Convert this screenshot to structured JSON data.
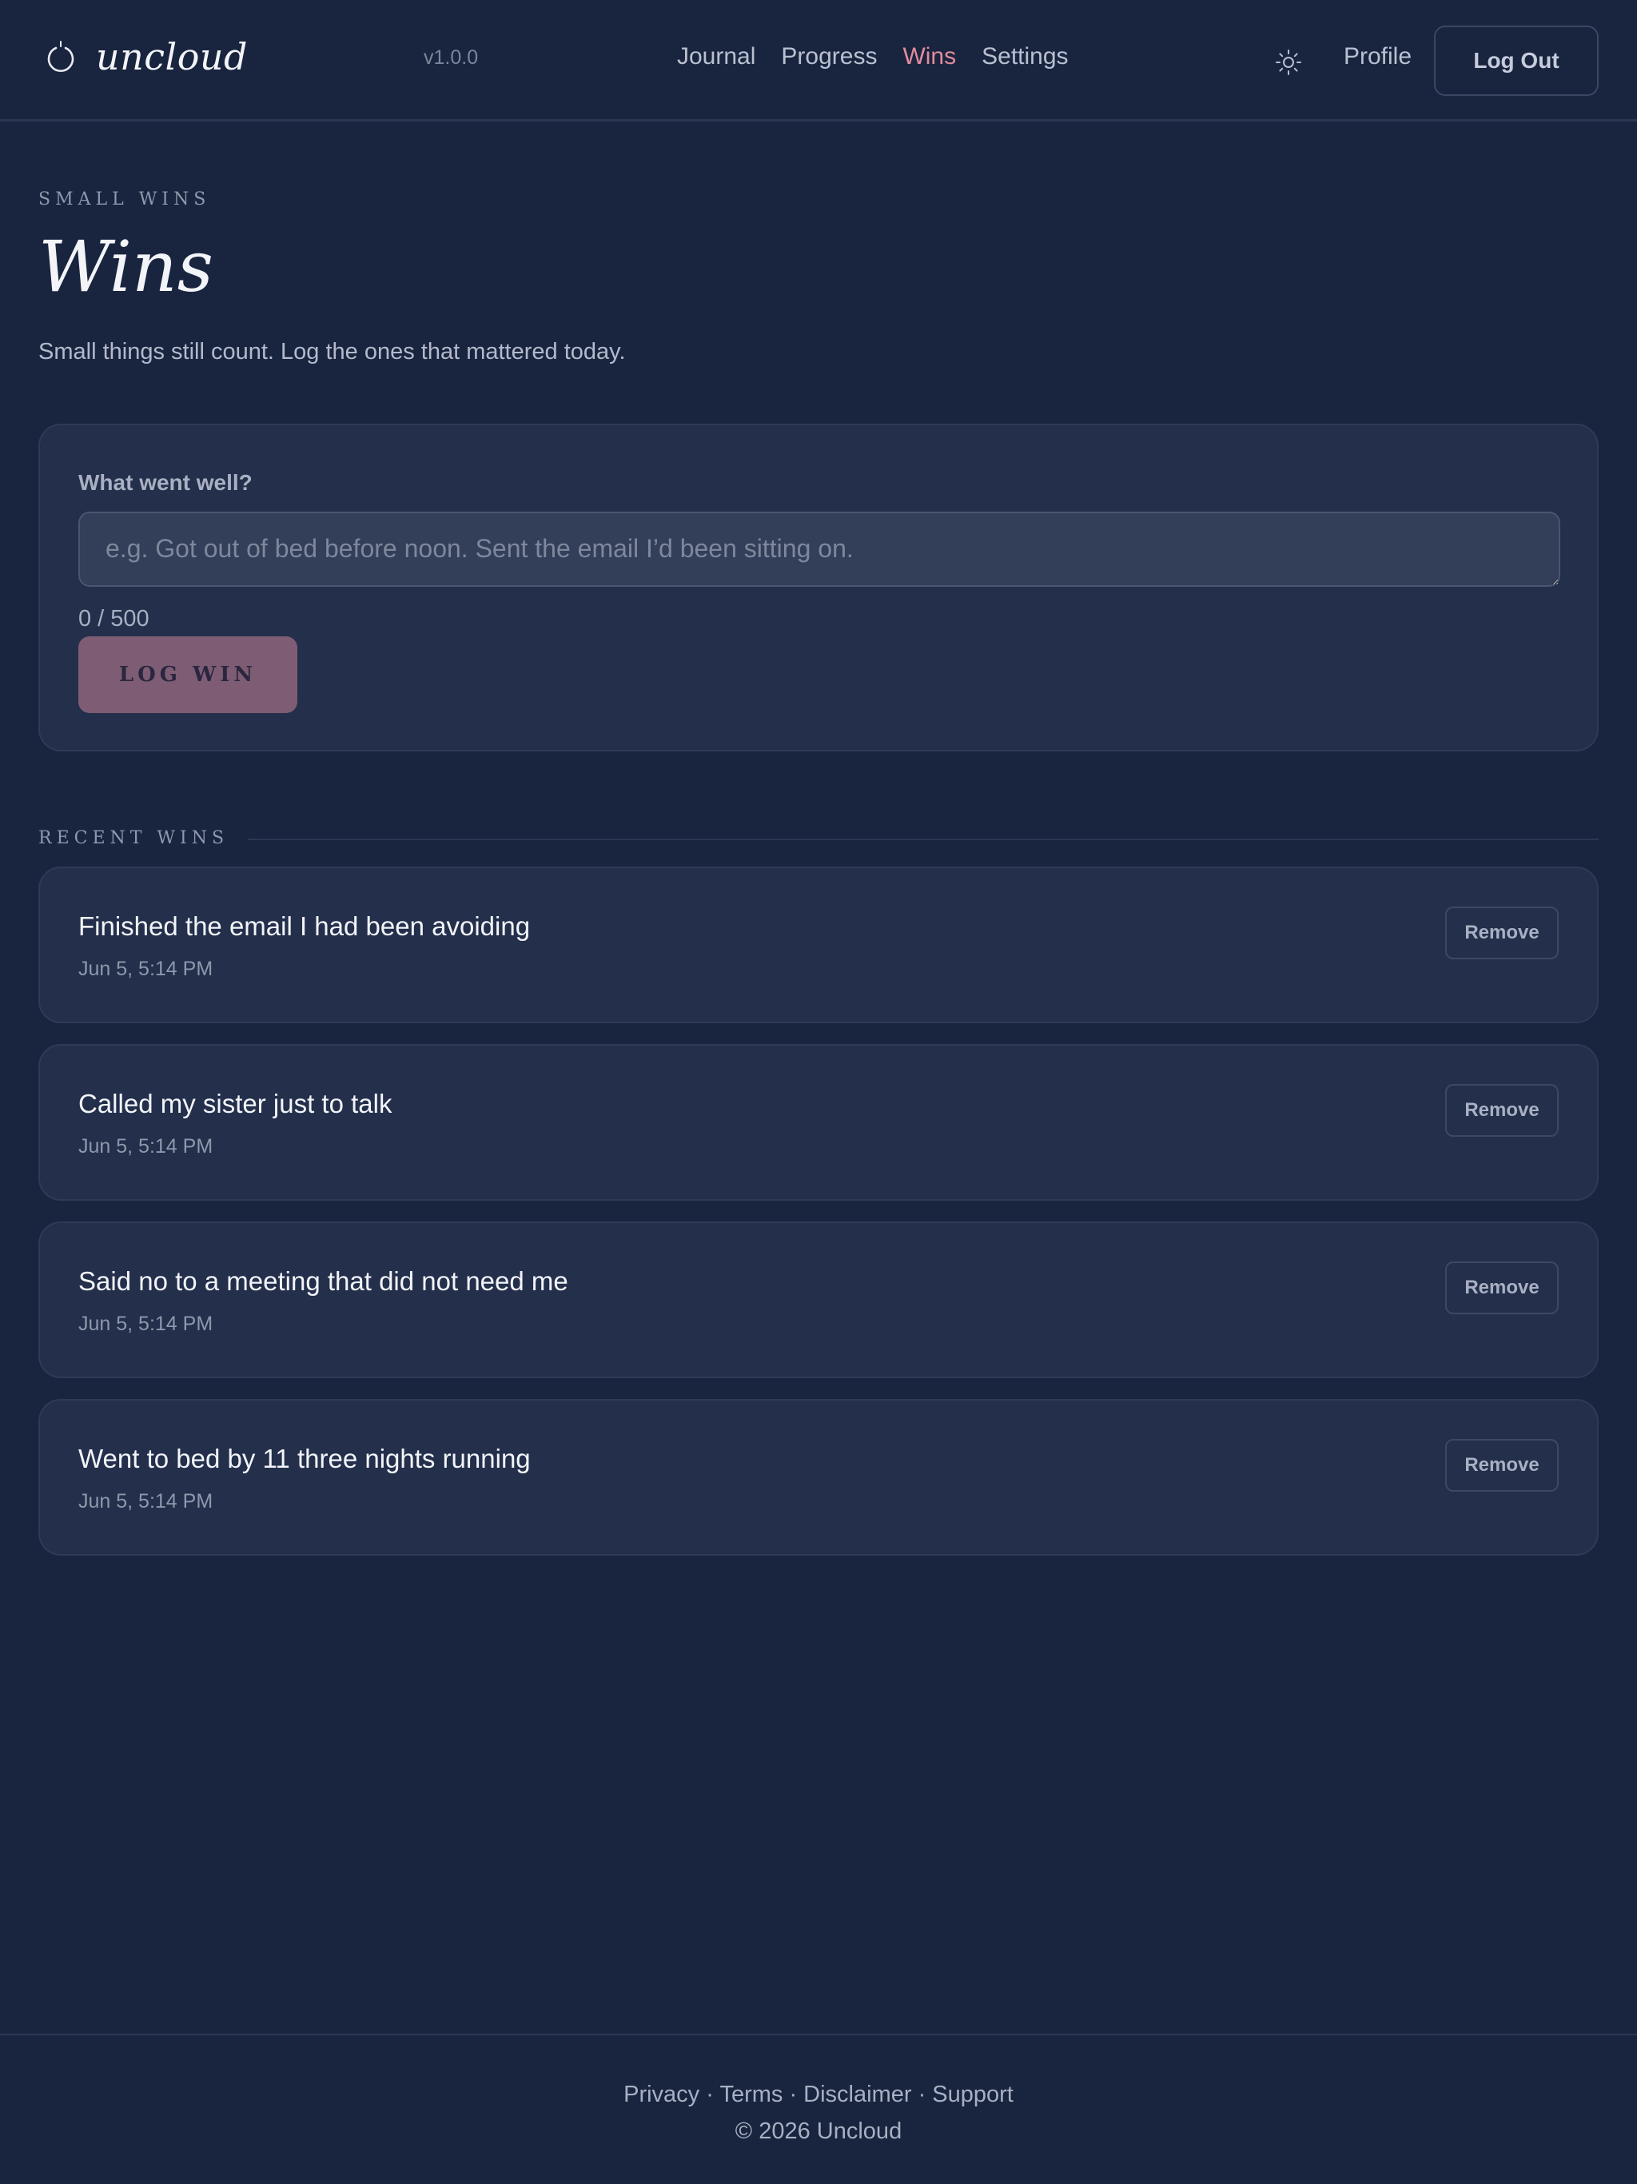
{
  "colors": {
    "background": "#19243f",
    "card": "#232f4b",
    "accent": "#e18c9c",
    "primary_button": "#7e5d74"
  },
  "header": {
    "brand_icon": "brand-circle-icon",
    "brand_name": "uncloud",
    "version": "v1.0.0",
    "nav": [
      {
        "label": "Journal",
        "active": false
      },
      {
        "label": "Progress",
        "active": false
      },
      {
        "label": "Wins",
        "active": true
      },
      {
        "label": "Settings",
        "active": false
      }
    ],
    "theme_icon": "sun-icon",
    "profile_label": "Profile",
    "logout_label": "Log Out"
  },
  "intro": {
    "eyebrow": "SMALL WINS",
    "title": "Wins",
    "subtitle": "Small things still count. Log the ones that mattered today."
  },
  "composer": {
    "label": "What went well?",
    "value": "",
    "placeholder": "e.g. Got out of bed before noon. Sent the email I’d been sitting on.",
    "char_count": "0 / 500",
    "submit_label": "LOG WIN"
  },
  "recent": {
    "label": "RECENT WINS",
    "remove_label": "Remove",
    "items": [
      {
        "text": "Finished the email I had been avoiding",
        "time": "Jun 5, 5:14 PM"
      },
      {
        "text": "Called my sister just to talk",
        "time": "Jun 5, 5:14 PM"
      },
      {
        "text": "Said no to a meeting that did not need me",
        "time": "Jun 5, 5:14 PM"
      },
      {
        "text": "Went to bed by 11 three nights running",
        "time": "Jun 5, 5:14 PM"
      }
    ]
  },
  "footer": {
    "links": [
      "Privacy",
      "Terms",
      "Disclaimer",
      "Support"
    ],
    "separator": " · ",
    "copyright": "© 2026 Uncloud"
  }
}
